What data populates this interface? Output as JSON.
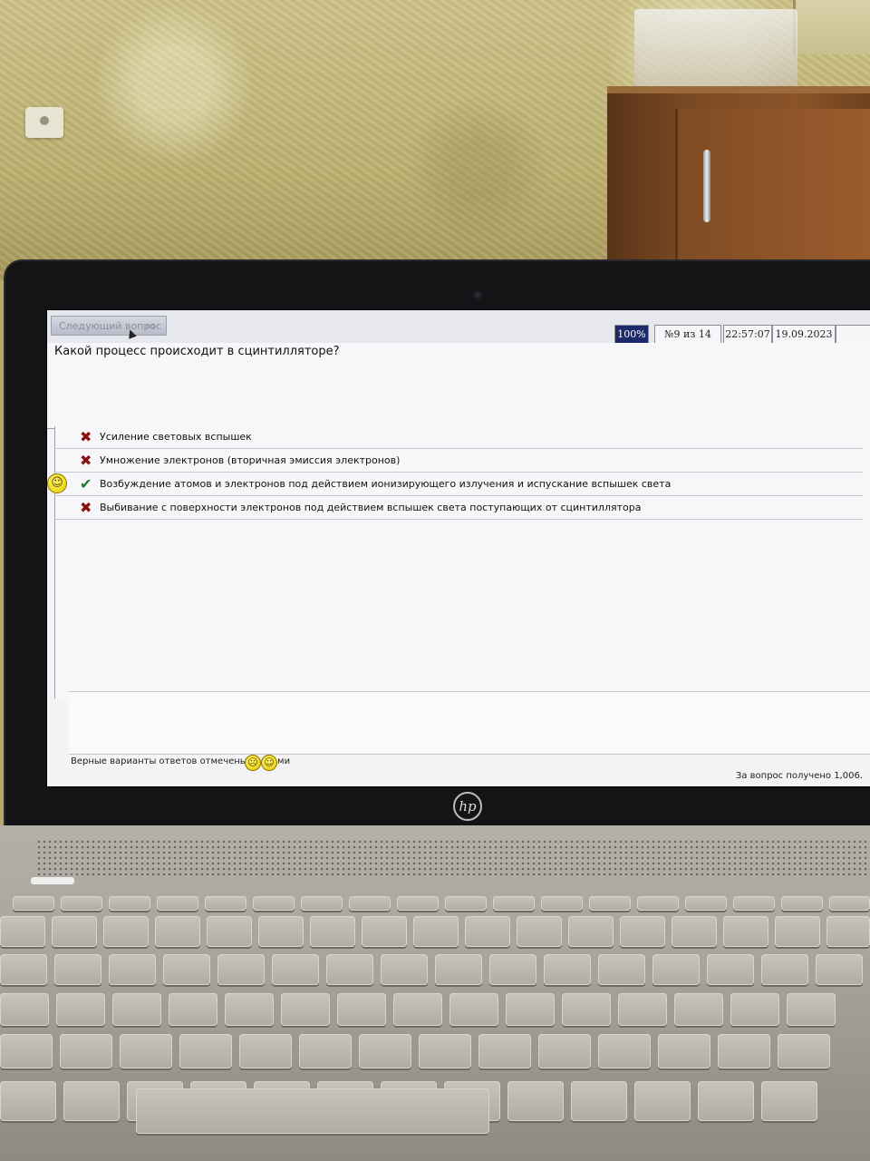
{
  "toolbar": {
    "next_label": "Следующий вопрос",
    "zoom": "100%",
    "progress": "№9 из 14",
    "time": "22:57:07",
    "date": "19.09.2023"
  },
  "question": "Какой процесс происходит в сцинтилляторе?",
  "answers": [
    {
      "text": "Усиление световых вспышек",
      "mark": "wrong"
    },
    {
      "text": "Умножение электронов (вторичная эмиссия электронов)",
      "mark": "wrong"
    },
    {
      "text": "Возбуждение атомов и электронов под действием ионизирующего излучения и испускание вспышек света",
      "mark": "correct"
    },
    {
      "text": "Выбивание с поверхности электронов под действием вспышек света поступающих от сцинтиллятора",
      "mark": "wrong"
    }
  ],
  "footer": {
    "legend_text": "Верные варианты ответов отмечены знаками",
    "score_text": "За вопрос получено 1,006."
  },
  "icons": {
    "wrong": "cross-icon",
    "correct": "check-icon",
    "smiley": "smiley-icon",
    "sad": "sad-face-icon",
    "cursor": "cursor-icon"
  },
  "colors": {
    "wrong": "#8a1010",
    "correct": "#1a7a2a",
    "zoom_bg": "#1c2a6a"
  },
  "brand": {
    "laptop_logo": "hp"
  }
}
